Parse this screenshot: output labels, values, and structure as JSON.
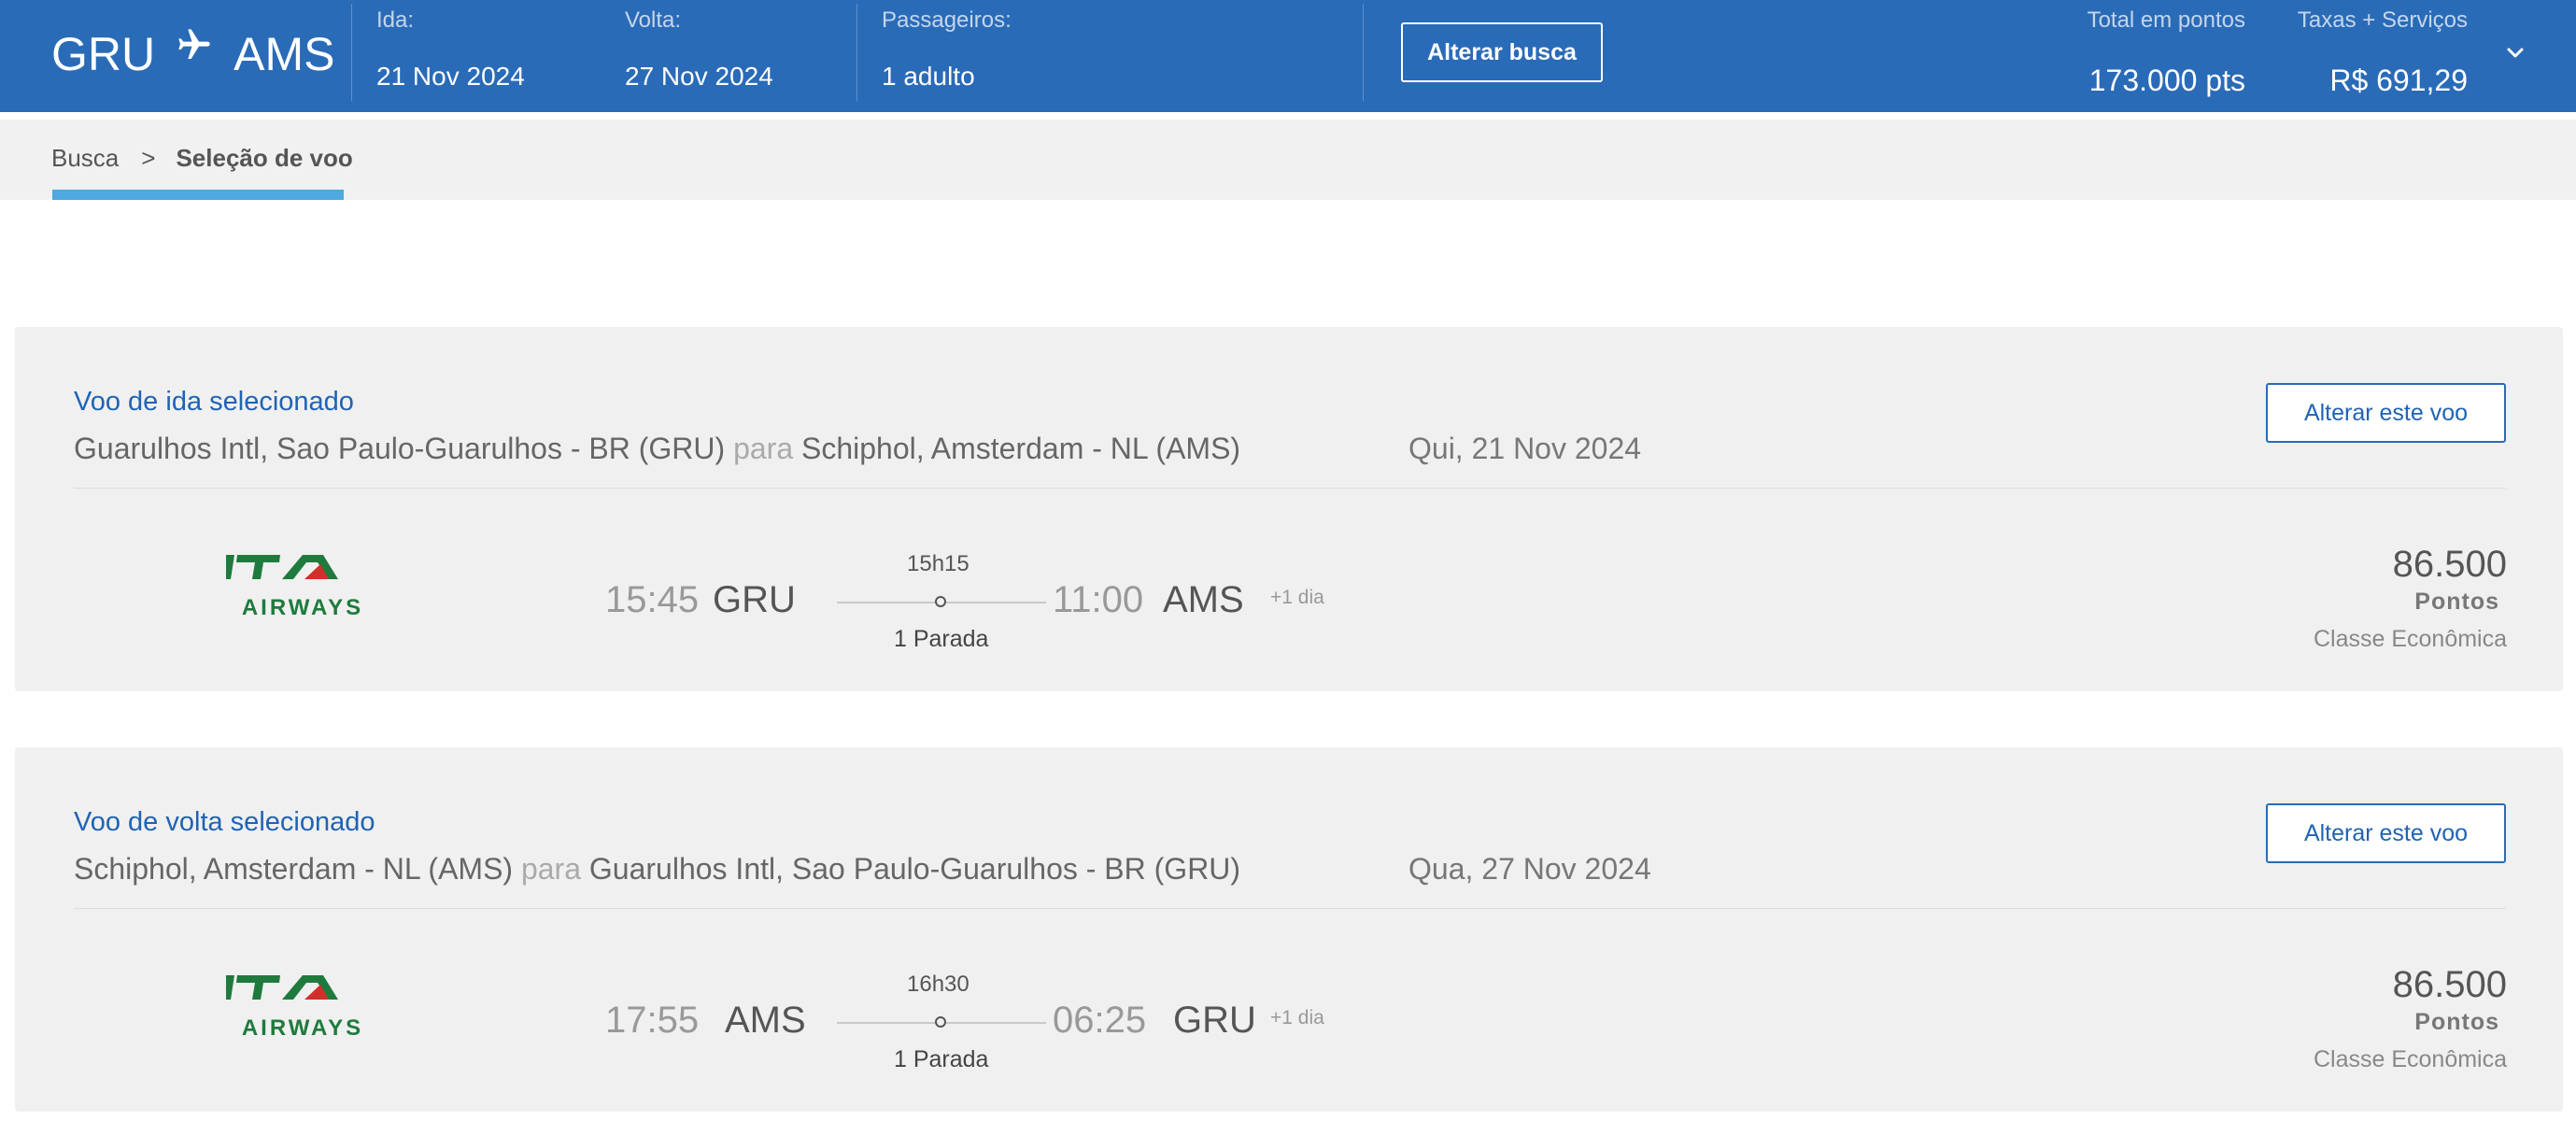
{
  "header": {
    "origin": "GRU",
    "destination": "AMS",
    "plane_icon": "airplane-icon",
    "ida_label": "Ida:",
    "ida_value": "21 Nov 2024",
    "volta_label": "Volta:",
    "volta_value": "27 Nov 2024",
    "passageiros_label": "Passageiros:",
    "passageiros_value": "1 adulto",
    "alterar_busca_label": "Alterar busca",
    "total_pontos_label": "Total em pontos",
    "total_pontos_value": "173.000 pts",
    "taxas_label": "Taxas + Serviços",
    "taxas_value": "R$ 691,29",
    "expand_icon": "chevron-down-icon",
    "bg_color": "#2a6bb8"
  },
  "breadcrumb": {
    "items": [
      "Busca",
      "Seleção de voo"
    ],
    "separator": ">",
    "active_color": "#4da9e0"
  },
  "flights": [
    {
      "title": "Voo de ida selecionado",
      "from": "Guarulhos Intl, Sao Paulo-Guarulhos - BR (GRU)",
      "connector": "para",
      "to": "Schiphol, Amsterdam - NL (AMS)",
      "date": "Qui, 21 Nov 2024",
      "change_label": "Alterar este voo",
      "airline_logo_text": "AIRWAYS",
      "dep_time": "15:45",
      "dep_airport": "GRU",
      "duration": "15h15",
      "stops": "1 Parada",
      "arr_time": "11:00",
      "arr_airport": "AMS",
      "plus_day": "+1 dia",
      "points": "86.500",
      "points_label": "Pontos",
      "cabin": "Classe Econômica"
    },
    {
      "title": "Voo de volta selecionado",
      "from": "Schiphol, Amsterdam - NL (AMS)",
      "connector": "para",
      "to": "Guarulhos Intl, Sao Paulo-Guarulhos - BR (GRU)",
      "date": "Qua, 27 Nov 2024",
      "change_label": "Alterar este voo",
      "airline_logo_text": "AIRWAYS",
      "dep_time": "17:55",
      "dep_airport": "AMS",
      "duration": "16h30",
      "stops": "1 Parada",
      "arr_time": "06:25",
      "arr_airport": "GRU",
      "plus_day": "+1 dia",
      "points": "86.500",
      "points_label": "Pontos",
      "cabin": "Classe Econômica"
    }
  ],
  "brand_colors": {
    "ita_green": "#1f7a3d",
    "ita_red": "#d22f2a",
    "link_blue": "#1f63b4"
  }
}
